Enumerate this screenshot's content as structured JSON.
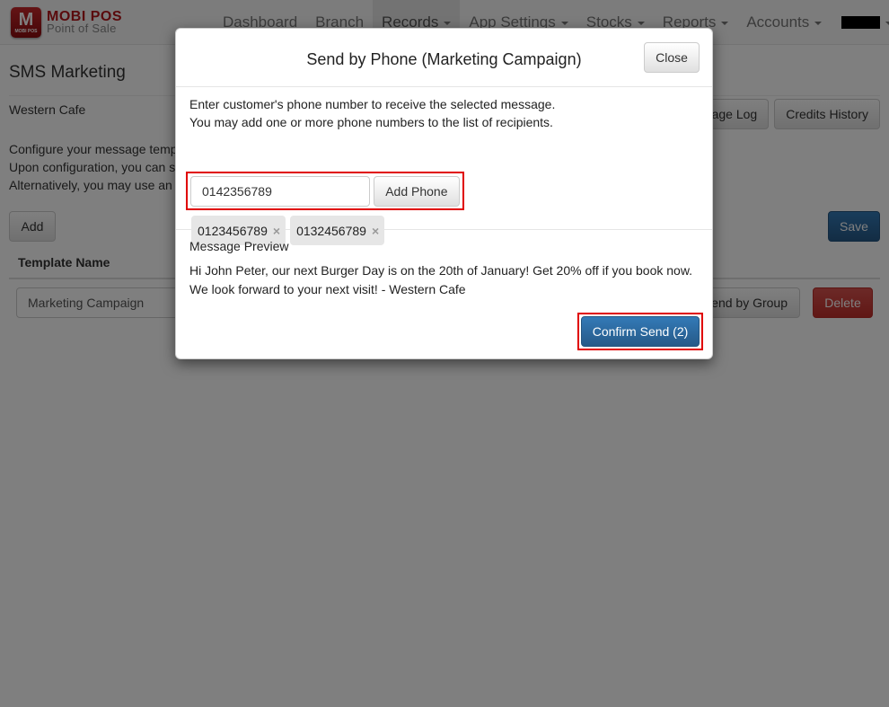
{
  "brand": {
    "logo_letter": "M",
    "logo_sub": "MOBI POS",
    "title": "MOBI POS",
    "subtitle": "Point of Sale"
  },
  "nav": {
    "items": [
      {
        "label": "Dashboard",
        "dropdown": false
      },
      {
        "label": "Branch",
        "dropdown": false
      },
      {
        "label": "Records",
        "dropdown": true,
        "active": true
      },
      {
        "label": "App Settings",
        "dropdown": true
      },
      {
        "label": "Stocks",
        "dropdown": true
      },
      {
        "label": "Reports",
        "dropdown": true
      },
      {
        "label": "Accounts",
        "dropdown": true
      }
    ],
    "user_menu": "redacted-user"
  },
  "page": {
    "title": "SMS Marketing",
    "branch": "Western Cafe",
    "description": [
      "Configure your message temp",
      "Upon configuration, you can s",
      "Alternatively, you may use an"
    ],
    "buttons": {
      "message_log": "Message Log",
      "credits_history": "Credits History",
      "add": "Add",
      "save": "Save",
      "send_by_group": "Send by Group",
      "delete": "Delete"
    },
    "table": {
      "column_template_name": "Template Name",
      "rows": [
        {
          "template_name": "Marketing Campaign"
        }
      ]
    }
  },
  "modal": {
    "title": "Send by Phone (Marketing Campaign)",
    "close_label": "Close",
    "instructions": [
      "Enter customer's phone number to receive the selected message.",
      "You may add one or more phone numbers to the list of recipients."
    ],
    "phone_input_value": "0142356789",
    "add_phone_label": "Add Phone",
    "recipients": [
      "0123456789",
      "0132456789"
    ],
    "remove_icon": "×",
    "preview_label": "Message Preview",
    "preview_text": [
      "Hi John Peter, our next Burger Day is on the 20th of January! Get 20% off if you book now.",
      "We look forward to your next visit! - Western Cafe"
    ],
    "confirm_label": "Confirm Send (2)"
  },
  "colors": {
    "brand_red": "#b5161a",
    "primary": "#337ab7",
    "danger": "#d9534f",
    "highlight_border": "#e00000"
  }
}
